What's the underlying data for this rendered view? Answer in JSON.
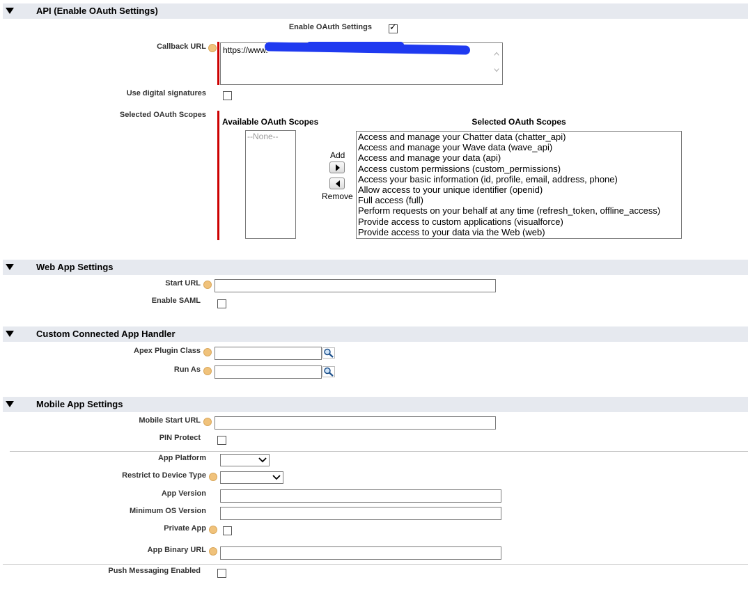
{
  "api": {
    "section_title": "API (Enable OAuth Settings)",
    "enable_oauth_label": "Enable OAuth Settings",
    "enable_oauth_checked": true,
    "callback_url_label": "Callback URL",
    "callback_url_value": "https://www.",
    "digital_signatures_label": "Use digital signatures",
    "selected_scopes_label": "Selected OAuth Scopes",
    "available_header": "Available OAuth Scopes",
    "selected_header": "Selected OAuth Scopes",
    "available_empty": "--None--",
    "add_label": "Add",
    "remove_label": "Remove",
    "selected_scopes": [
      "Access and manage your Chatter data (chatter_api)",
      "Access and manage your Wave data (wave_api)",
      "Access and manage your data (api)",
      "Access custom permissions (custom_permissions)",
      "Access your basic information (id, profile, email, address, phone)",
      "Allow access to your unique identifier (openid)",
      "Full access (full)",
      "Perform requests on your behalf at any time (refresh_token, offline_access)",
      "Provide access to custom applications (visualforce)",
      "Provide access to your data via the Web (web)"
    ]
  },
  "web": {
    "section_title": "Web App Settings",
    "start_url_label": "Start URL",
    "enable_saml_label": "Enable SAML"
  },
  "custom": {
    "section_title": "Custom Connected App Handler",
    "apex_plugin_label": "Apex Plugin Class",
    "run_as_label": "Run As"
  },
  "mobile": {
    "section_title": "Mobile App Settings",
    "mobile_start_url_label": "Mobile Start URL",
    "pin_protect_label": "PIN Protect",
    "app_platform_label": "App Platform",
    "restrict_device_label": "Restrict to Device Type",
    "app_version_label": "App Version",
    "min_os_label": "Minimum OS Version",
    "private_app_label": "Private App",
    "app_binary_url_label": "App Binary URL",
    "push_messaging_label": "Push Messaging Enabled"
  }
}
